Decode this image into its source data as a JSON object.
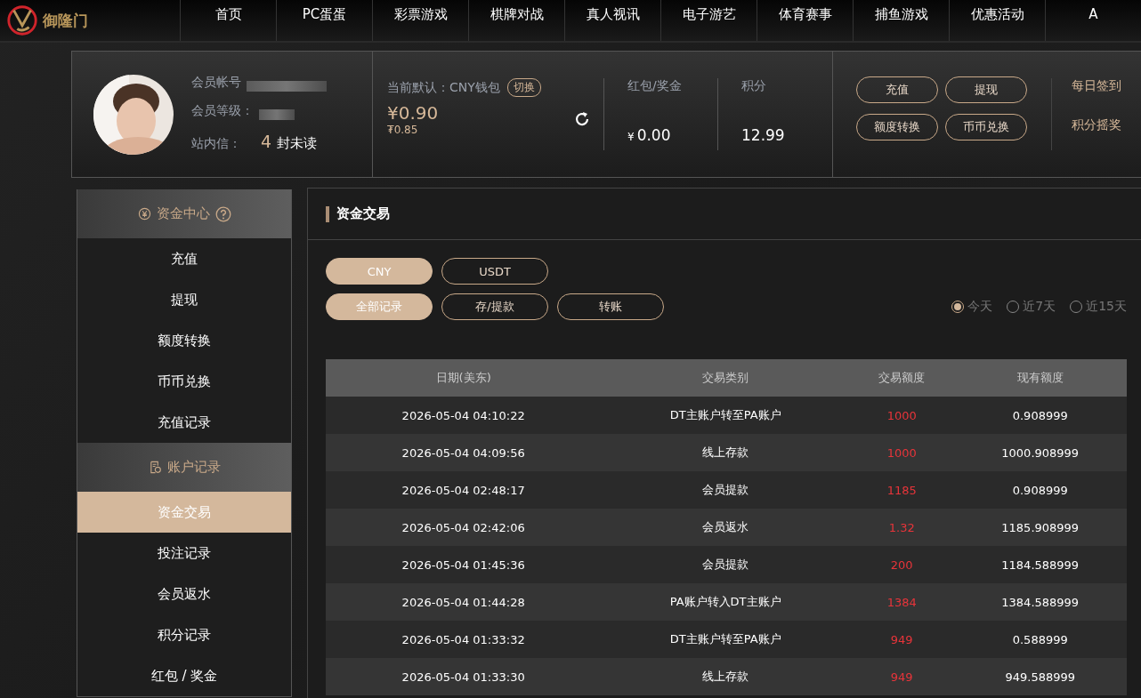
{
  "logo": {
    "text": "御隆门"
  },
  "nav": [
    "首页",
    "PC蛋蛋",
    "彩票游戏",
    "棋牌对战",
    "真人视讯",
    "电子游艺",
    "体育赛事",
    "捕鱼游戏",
    "优惠活动",
    "A"
  ],
  "profile": {
    "account_label": "会员帐号",
    "level_label": "会员等级：",
    "messages_label": "站内信：",
    "messages_count": "4",
    "messages_suffix": "封未读"
  },
  "wallet": {
    "default_label": "当前默认：CNY钱包",
    "switch_button": "切换",
    "balance": "¥0.90",
    "sub_balance": "₮0.85"
  },
  "bonus": {
    "label": "红包/奖金",
    "currency": "¥",
    "value": "0.00"
  },
  "points": {
    "label": "积分",
    "value": "12.99"
  },
  "actions": [
    "充值",
    "提现",
    "额度转换",
    "币币兑换"
  ],
  "links": [
    "每日签到",
    "积分摇奖"
  ],
  "sidebar": [
    {
      "title": "资金中心",
      "items": [
        {
          "label": "充值",
          "selected": false
        },
        {
          "label": "提现",
          "selected": false
        },
        {
          "label": "额度转换",
          "selected": false
        },
        {
          "label": "币币兑换",
          "selected": false
        },
        {
          "label": "充值记录",
          "selected": false
        }
      ]
    },
    {
      "title": "账户记录",
      "items": [
        {
          "label": "资金交易",
          "selected": true
        },
        {
          "label": "投注记录",
          "selected": false
        },
        {
          "label": "会员返水",
          "selected": false
        },
        {
          "label": "积分记录",
          "selected": false
        },
        {
          "label": "红包 / 奖金",
          "selected": false
        }
      ]
    }
  ],
  "panel": {
    "title": "资金交易",
    "currency_tabs": [
      {
        "label": "CNY",
        "selected": true
      },
      {
        "label": "USDT",
        "selected": false
      }
    ],
    "type_tabs": [
      {
        "label": "全部记录",
        "selected": true
      },
      {
        "label": "存/提款",
        "selected": false
      },
      {
        "label": "转账",
        "selected": false
      }
    ],
    "periods": [
      {
        "label": "今天",
        "selected": true
      },
      {
        "label": "近7天",
        "selected": false
      },
      {
        "label": "近15天",
        "selected": false
      }
    ],
    "table": {
      "columns": [
        "日期(美东)",
        "交易类别",
        "交易额度",
        "现有额度"
      ],
      "rows": [
        [
          "2026-05-04 04:10:22",
          "DT主账户转至PA账户",
          "1000",
          "0.908999"
        ],
        [
          "2026-05-04 04:09:56",
          "线上存款",
          "1000",
          "1000.908999"
        ],
        [
          "2026-05-04 02:48:17",
          "会员提款",
          "1185",
          "0.908999"
        ],
        [
          "2026-05-04 02:42:06",
          "会员返水",
          "1.32",
          "1185.908999"
        ],
        [
          "2026-05-04 01:45:36",
          "会员提款",
          "200",
          "1184.588999"
        ],
        [
          "2026-05-04 01:44:28",
          "PA账户转入DT主账户",
          "1384",
          "1384.588999"
        ],
        [
          "2026-05-04 01:33:32",
          "DT主账户转至PA账户",
          "949",
          "0.588999"
        ],
        [
          "2026-05-04 01:33:30",
          "线上存款",
          "949",
          "949.588999"
        ]
      ]
    }
  }
}
